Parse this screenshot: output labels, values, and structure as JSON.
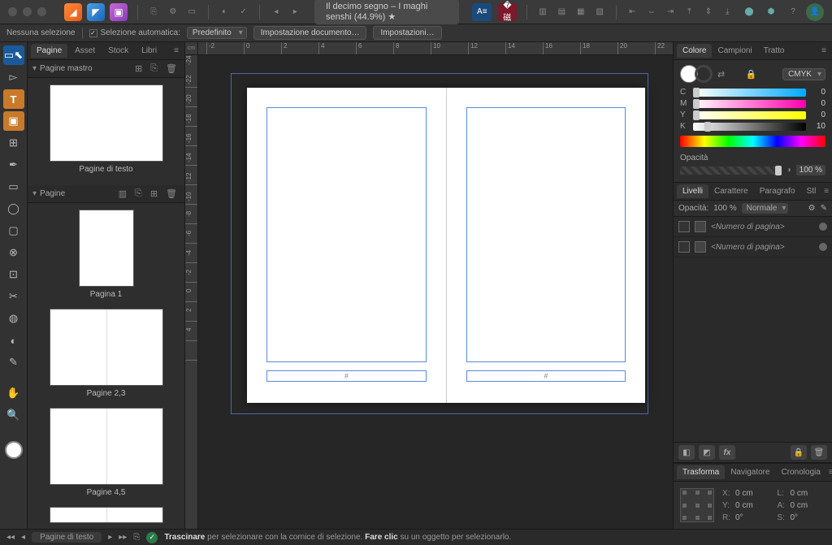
{
  "doc_title": "Il decimo segno – I maghi senshi (44.9%) ★",
  "ctx": {
    "no_selection": "Nessuna selezione",
    "auto_select": "Selezione automatica:",
    "preset": "Predefinito",
    "doc_setup": "Impostazione documento…",
    "prefs": "Impostazioni…"
  },
  "ruler_unit": "cm",
  "left": {
    "tabs": {
      "pages": "Pagine",
      "asset": "Asset",
      "stock": "Stock",
      "books": "Libri"
    },
    "master_hdr": "Pagine mastro",
    "master_name": "Pagine di testo",
    "pages_hdr": "Pagine",
    "page1": "Pagina 1",
    "page23": "Pagine 2,3",
    "page45": "Pagine 4,5"
  },
  "folio_placeholder": "#",
  "color": {
    "tabs": {
      "color": "Colore",
      "swatches": "Campioni",
      "stroke": "Tratto"
    },
    "mode": "CMYK",
    "c": "C",
    "m": "M",
    "y": "Y",
    "k": "K",
    "cv": "0",
    "mv": "0",
    "yv": "0",
    "kv": "10",
    "opacity_lbl": "Opacità",
    "opacity_val": "100 %"
  },
  "layers": {
    "tabs": {
      "layers": "Livelli",
      "character": "Carattere",
      "paragraph": "Paragrafo",
      "styles": "Stl"
    },
    "opacity_lbl": "Opacità:",
    "opacity_val": "100 %",
    "blend": "Normale",
    "item_name": "<Numero di pagina>"
  },
  "transform": {
    "tabs": {
      "transform": "Trasforma",
      "navigator": "Navigatore",
      "history": "Cronologia"
    },
    "x": "X:",
    "y": "Y:",
    "w": "L:",
    "h": "A:",
    "r": "R:",
    "s": "S:",
    "xv": "0 cm",
    "yv": "0 cm",
    "wv": "0 cm",
    "hv": "0 cm",
    "rv": "0°",
    "sv": "0°"
  },
  "status": {
    "spread": "Pagine di testo",
    "hint_pre": "Trascinare ",
    "hint_mid": "per selezionare con la cornice di selezione. ",
    "hint_bold2": "Fare clic ",
    "hint_end": "su un oggetto per selezionarlo."
  }
}
